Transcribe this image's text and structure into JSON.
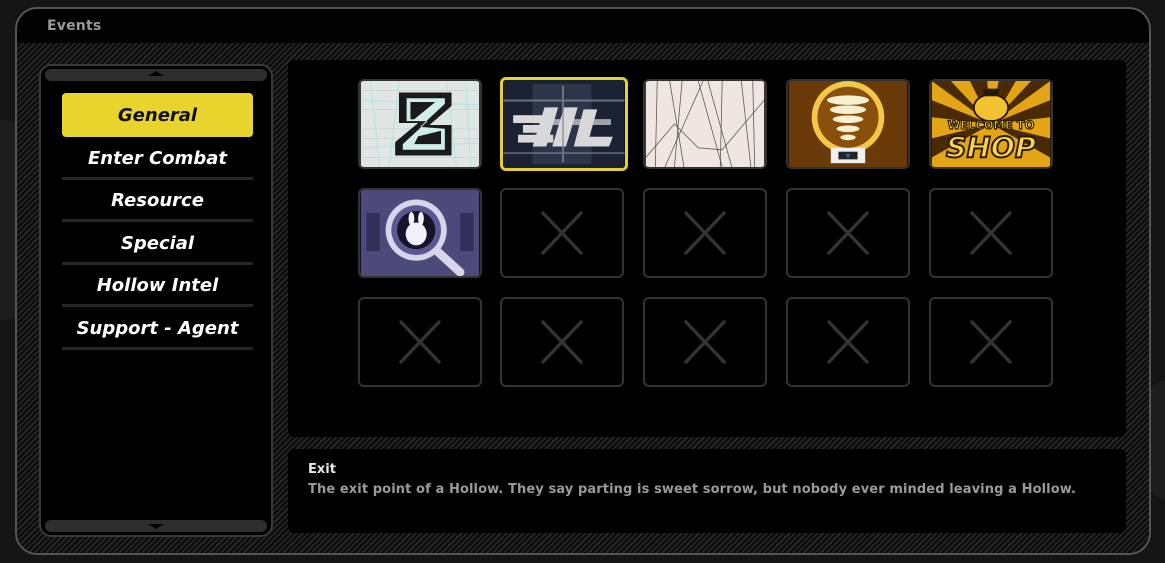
{
  "window": {
    "title": "Events"
  },
  "categories": {
    "items": [
      {
        "label": "General",
        "active": true
      },
      {
        "label": "Enter Combat",
        "active": false
      },
      {
        "label": "Resource",
        "active": false
      },
      {
        "label": "Special",
        "active": false
      },
      {
        "label": "Hollow Intel",
        "active": false
      },
      {
        "label": "Support - Agent",
        "active": false
      }
    ],
    "scroll_up_icon": "chevron-up-icon",
    "scroll_down_icon": "chevron-down-icon"
  },
  "event_grid": {
    "selected_index": 1,
    "slots": [
      {
        "icon": "zzz-logo-icon",
        "state": "unlocked",
        "selected": false
      },
      {
        "icon": "exit-glitch-icon",
        "state": "unlocked",
        "selected": true
      },
      {
        "icon": "lines-pattern-icon",
        "state": "unlocked",
        "selected": false
      },
      {
        "icon": "lightbulb-icon",
        "state": "unlocked",
        "selected": false
      },
      {
        "icon": "welcome-to-shop-icon",
        "state": "unlocked",
        "selected": false
      },
      {
        "icon": "magnifier-bangboo-icon",
        "state": "unlocked",
        "selected": false
      },
      {
        "icon": "locked-x-icon",
        "state": "empty"
      },
      {
        "icon": "locked-x-icon",
        "state": "empty"
      },
      {
        "icon": "locked-x-icon",
        "state": "empty"
      },
      {
        "icon": "locked-x-icon",
        "state": "empty"
      },
      {
        "icon": "locked-x-icon",
        "state": "empty"
      },
      {
        "icon": "locked-x-icon",
        "state": "empty"
      },
      {
        "icon": "locked-x-icon",
        "state": "empty"
      },
      {
        "icon": "locked-x-icon",
        "state": "empty"
      },
      {
        "icon": "locked-x-icon",
        "state": "empty"
      }
    ],
    "shop_text": {
      "line1": "WELCOME TO",
      "line2": "SHOP"
    }
  },
  "description": {
    "title": "Exit",
    "text": "The exit point of a Hollow. They say parting is sweet sorrow, but nobody ever minded leaving a Hollow."
  },
  "colors": {
    "accent_yellow": "#e8d42c",
    "selected_border": "#e6d030",
    "empty_slot_border": "#333333",
    "text_gray": "#9a9a9a"
  }
}
